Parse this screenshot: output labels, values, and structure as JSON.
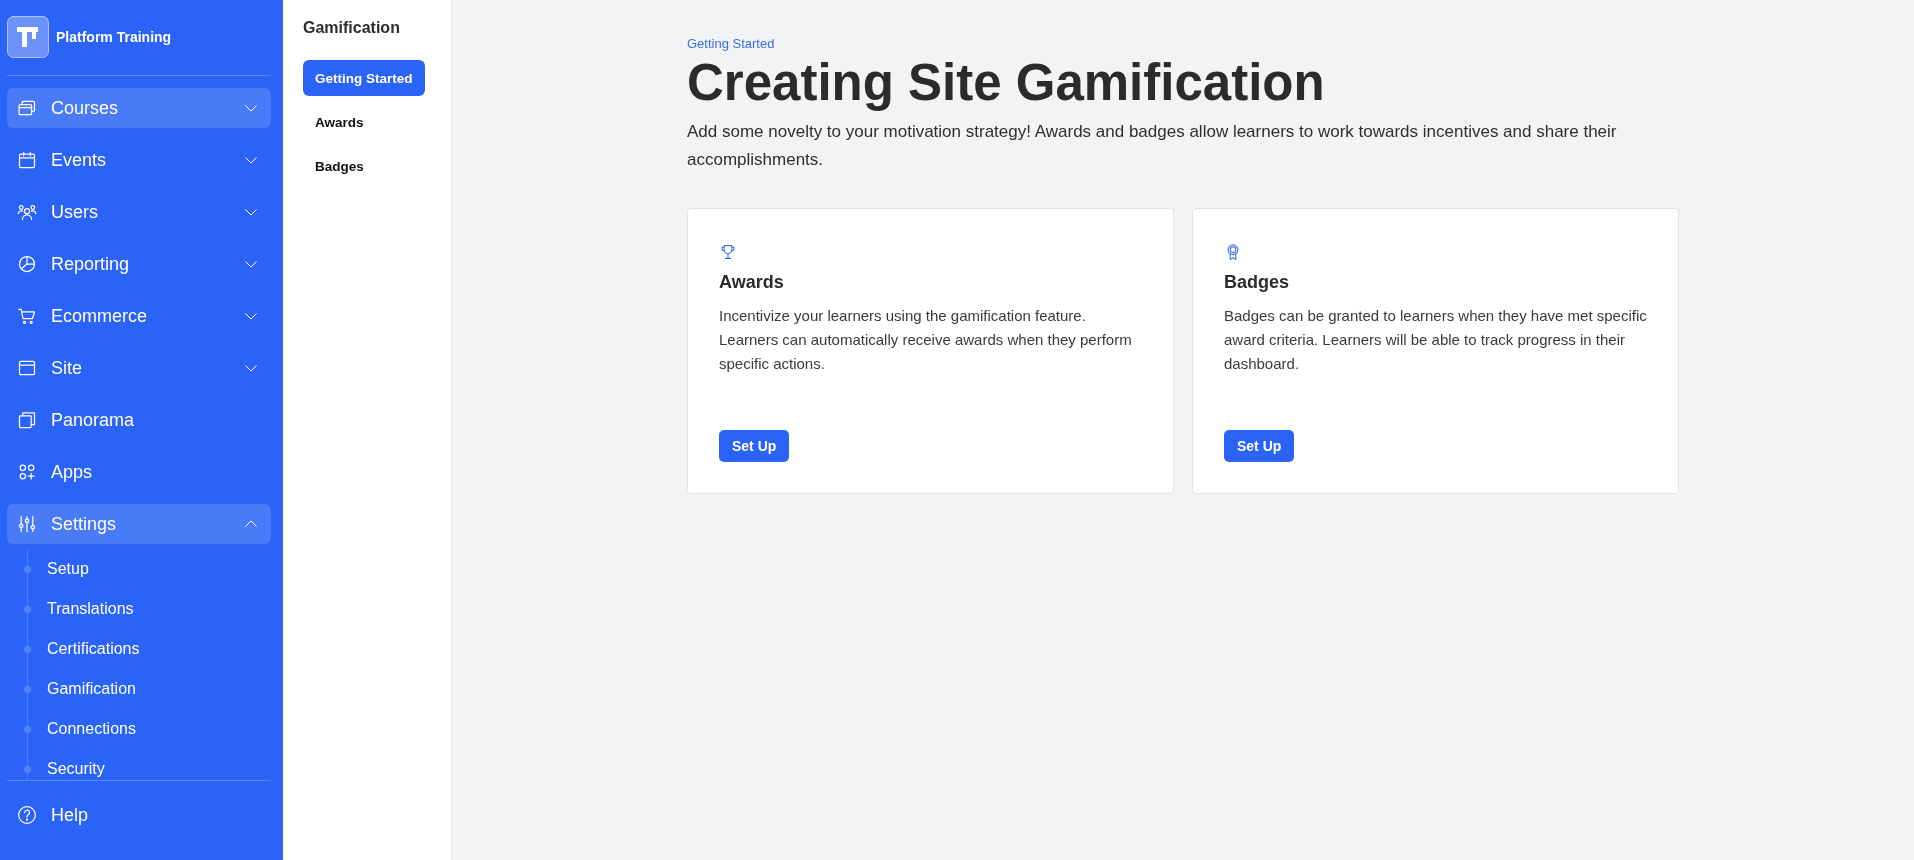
{
  "sidebar": {
    "brand": {
      "name": "Platform Training"
    },
    "nav": [
      {
        "label": "Courses",
        "kind": "group",
        "selected": true,
        "expanded": false
      },
      {
        "label": "Events",
        "kind": "group",
        "selected": false,
        "expanded": false
      },
      {
        "label": "Users",
        "kind": "group",
        "selected": false,
        "expanded": false
      },
      {
        "label": "Reporting",
        "kind": "group",
        "selected": false,
        "expanded": false
      },
      {
        "label": "Ecommerce",
        "kind": "group",
        "selected": false,
        "expanded": false
      },
      {
        "label": "Site",
        "kind": "group",
        "selected": false,
        "expanded": false
      },
      {
        "label": "Panorama",
        "kind": "link",
        "selected": false
      },
      {
        "label": "Apps",
        "kind": "link",
        "selected": false
      },
      {
        "label": "Settings",
        "kind": "group",
        "selected": true,
        "expanded": true,
        "children": [
          {
            "label": "Setup"
          },
          {
            "label": "Translations"
          },
          {
            "label": "Certifications"
          },
          {
            "label": "Gamification"
          },
          {
            "label": "Connections"
          },
          {
            "label": "Security"
          }
        ]
      }
    ],
    "footer": [
      {
        "label": "Help"
      }
    ]
  },
  "subnav": {
    "title": "Gamification",
    "items": [
      {
        "label": "Getting Started",
        "selected": true
      },
      {
        "label": "Awards",
        "selected": false
      },
      {
        "label": "Badges",
        "selected": false
      }
    ]
  },
  "main": {
    "breadcrumb": "Getting Started",
    "title": "Creating Site Gamification",
    "description": "Add some novelty to your motivation strategy! Awards and badges allow learners to work towards incentives and share their accomplishments.",
    "cards": [
      {
        "title": "Awards",
        "description": "Incentivize your learners using the gamification feature. Learners can automatically receive awards when they perform specific actions.",
        "button": "Set Up"
      },
      {
        "title": "Badges",
        "description": "Badges can be granted to learners when they have met specific award criteria. Learners will be able to track progress in their dashboard.",
        "button": "Set Up"
      }
    ]
  }
}
